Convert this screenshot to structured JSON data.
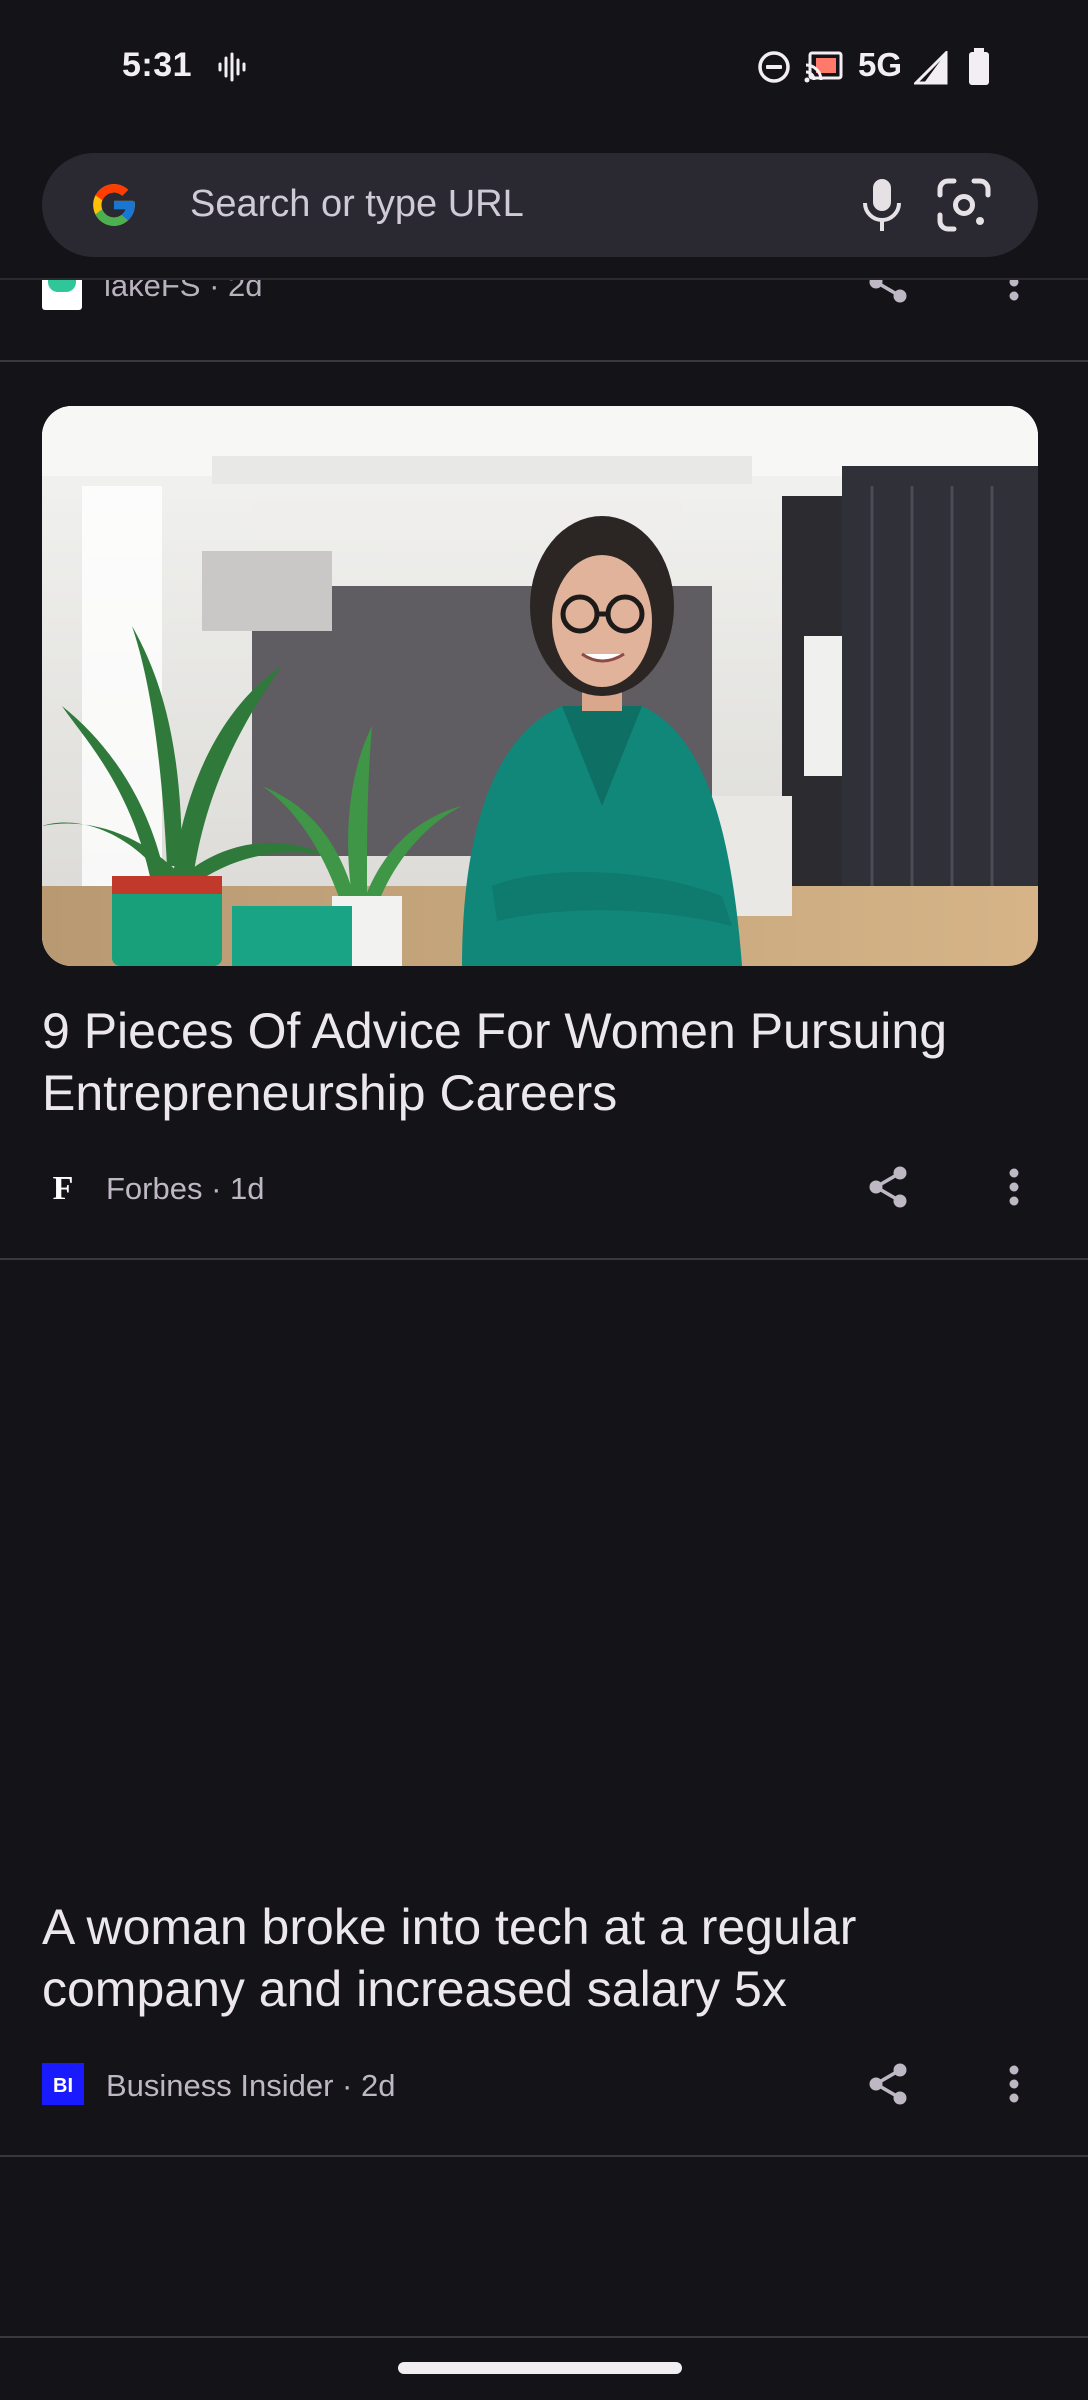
{
  "status_bar": {
    "time": "5:31",
    "network": "5G",
    "icons": [
      "voice-assistant-icon",
      "do-not-disturb-icon",
      "cast-icon",
      "signal-icon",
      "battery-icon"
    ]
  },
  "search_bar": {
    "placeholder": "Search or type URL",
    "icons": [
      "google-logo",
      "microphone-icon",
      "google-lens-icon"
    ]
  },
  "feed": {
    "partial_card": {
      "source": "lakeFS · 2d"
    },
    "articles": [
      {
        "title": "9 Pieces Of Advice For Women Pursuing Entrepreneurship Careers",
        "source": "Forbes · 1d",
        "logo_text": "F",
        "has_image": true
      },
      {
        "title": "A woman broke into tech at a regular company and increased salary 5x",
        "source": "Business Insider · 2d",
        "logo_text": "BI",
        "has_image": false
      }
    ]
  },
  "colors": {
    "background": "#141318",
    "search_bar": "#2a2932",
    "divider": "#39383f",
    "bi_logo": "#1a1aff"
  }
}
